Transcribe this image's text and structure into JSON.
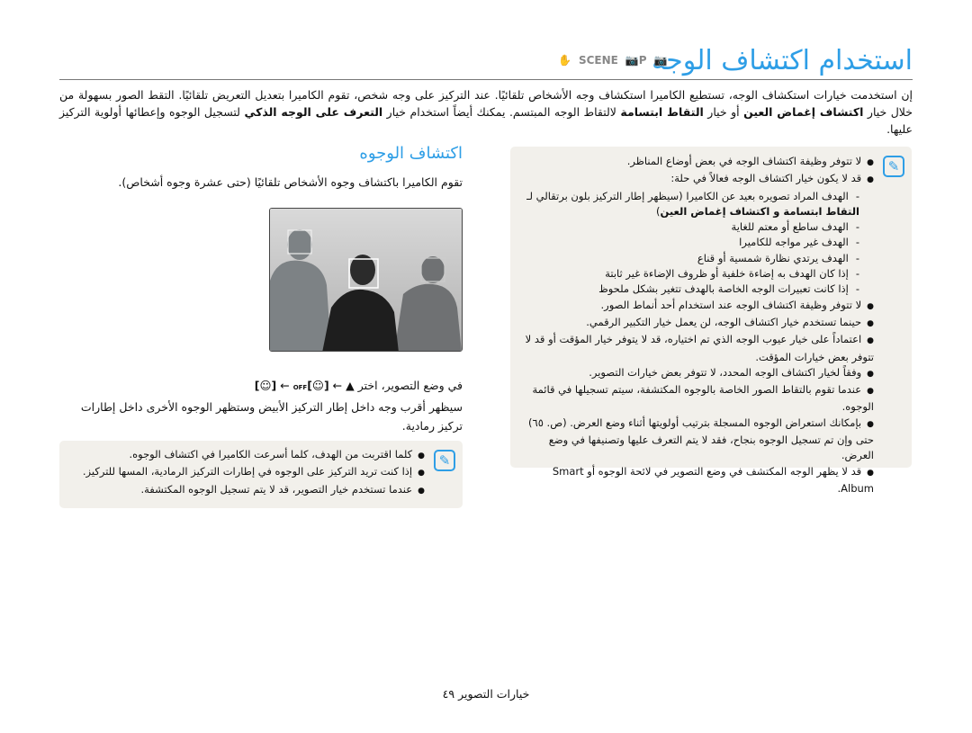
{
  "title": "استخدام اكتشاف الوجه",
  "mode_icons": [
    "camera-icon",
    "program-icon",
    "scene-icon",
    "dual-is-icon"
  ],
  "mode_icon_labels": {
    "scene": "SCENE"
  },
  "intro": {
    "p1": "إن استخدمت خيارات استكشاف الوجه، تستطيع الكاميرا استكشاف وجه الأشخاص تلقائيًا. عند التركيز على وجه شخص، تقوم الكاميرا بتعديل التعريض تلقائيًا. التقط الصور بسهولة من خلال خيار ",
    "b1": "اكتشاف إغماض العين",
    "p2": " أو خيار ",
    "b2": "التقاط ابتسامة",
    "p3": " لالتقاط الوجه المبتسم. يمكنك أيضاً استخدام خيار ",
    "b3": "التعرف على الوجه الذكي",
    "p4": " لتسجيل الوجوه وإعطائها أولوية التركيز عليها."
  },
  "right_note": {
    "items": [
      {
        "type": "bullet",
        "text": "لا تتوفر وظيفة اكتشاف الوجه في بعض أوضاع المناظر."
      },
      {
        "type": "bullet",
        "text": "قد لا يكون خيار اكتشاف الوجه فعالاً في حلة:"
      },
      {
        "type": "dash",
        "text": "الهدف المراد تصويره بعيد عن الكاميرا (سيظهر إطار التركيز بلون برتقالي لـ ",
        "bold": "التقاط ابتسامة و اكتشاف إغماض العين",
        "tail": ")"
      },
      {
        "type": "dash",
        "text": "الهدف ساطع أو معتم للغاية"
      },
      {
        "type": "dash",
        "text": "الهدف غير مواجه للكاميرا"
      },
      {
        "type": "dash",
        "text": "الهدف يرتدي نظارة شمسية أو قناع"
      },
      {
        "type": "dash",
        "text": "إذا كان الهدف به إضاءة خلفية أو ظروف الإضاءة غير ثابتة"
      },
      {
        "type": "dash",
        "text": "إذا كانت تعبيرات الوجه الخاصة بالهدف تتغير بشكل ملحوظ"
      },
      {
        "type": "bullet",
        "text": "لا تتوفر وظيفة اكتشاف الوجه عند استخدام أحد أنماط الصور."
      },
      {
        "type": "bullet",
        "text": "حينما تستخدم خيار اكتشاف الوجه، لن يعمل خيار التكبير الرقمي."
      },
      {
        "type": "bullet",
        "text": "اعتماداً على خيار عيوب الوجه الذي تم اختياره، قد لا يتوفر خيار المؤقت أو قد لا تتوفر بعض خيارات المؤقت."
      },
      {
        "type": "bullet",
        "text": "وفقاً لخيار اكتشاف الوجه المحدد، لا تتوفر بعض خيارات التصوير."
      },
      {
        "type": "bullet",
        "text": "عندما تقوم بالتقاط الصور الخاصة بالوجوه المكتشفة، سيتم تسجيلها في قائمة الوجوه."
      },
      {
        "type": "bullet",
        "text": "بإمكانك استعراض الوجوه المسجلة بترتيب أولويتها أثناء وضع العرض. (ص. ٦٥) حتى وإن تم تسجيل الوجوه بنجاح، فقد لا يتم التعرف عليها وتصنيفها في وضع العرض."
      },
      {
        "type": "bullet",
        "text": "قد لا يظهر الوجه المكتشف في وضع التصوير في لائحة الوجوه أو Smart Album."
      }
    ]
  },
  "section": {
    "heading": "اكتشاف الوجوه",
    "description": "تقوم الكاميرا باكتشاف وجوه الأشخاص تلقائيًا (حتى عشرة وجوه أشخاص).",
    "step_prefix": "في وضع التصوير، اختر",
    "arrow": "←",
    "step_text": "سيظهر أقرب وجه داخل إطار التركيز الأبيض وستظهر الوجوه الأخرى داخل إطارات تركيز رمادية.",
    "off_label": "OFF"
  },
  "left_note": {
    "items": [
      "كلما اقتربت من الهدف، كلما أسرعت الكاميرا في اكتشاف الوجوه.",
      "إذا كنت تريد التركيز على الوجوه في إطارات التركيز الرمادية، المسها للتركيز.",
      "عندما تستخدم خيار التصوير، قد لا يتم تسجيل الوجوه المكتشفة."
    ]
  },
  "footer": {
    "section": "خيارات التصوير",
    "page": "٤٩"
  },
  "colors": {
    "accent": "#2e9ee6",
    "note_bg": "#f2f0eb"
  }
}
